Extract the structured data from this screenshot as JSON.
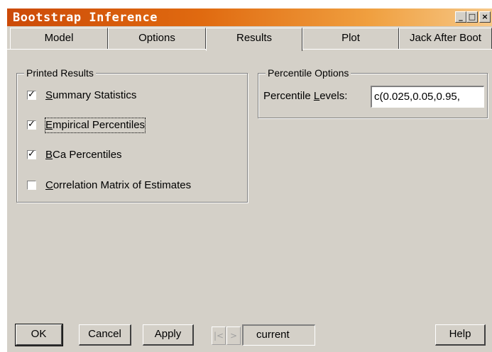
{
  "window": {
    "title": "Bootstrap Inference",
    "controls": {
      "minimize": "_",
      "maximize": "□",
      "close": "×"
    }
  },
  "tabs": [
    {
      "label": "Model"
    },
    {
      "label": "Options"
    },
    {
      "label": "Results",
      "active": true
    },
    {
      "label": "Plot"
    },
    {
      "label": "Jack After Boot"
    }
  ],
  "printed_results": {
    "title": "Printed Results",
    "items": [
      {
        "pre": "",
        "key": "S",
        "post": "ummary Statistics",
        "checked": true
      },
      {
        "pre": "",
        "key": "E",
        "post": "mpirical Percentiles",
        "checked": true
      },
      {
        "pre": "",
        "key": "B",
        "post": "Ca Percentiles",
        "checked": true
      },
      {
        "pre": "",
        "key": "C",
        "post": "orrelation Matrix of Estimates",
        "checked": false
      }
    ]
  },
  "percentile_options": {
    "title": "Percentile Options",
    "label_pre": "Percentile ",
    "label_key": "L",
    "label_post": "evels:",
    "value": "c(0.025,0.05,0.95,"
  },
  "buttons": {
    "ok": "OK",
    "cancel": "Cancel",
    "apply": "Apply",
    "prev": "|<",
    "next": ">",
    "current": "current",
    "help": "Help"
  }
}
